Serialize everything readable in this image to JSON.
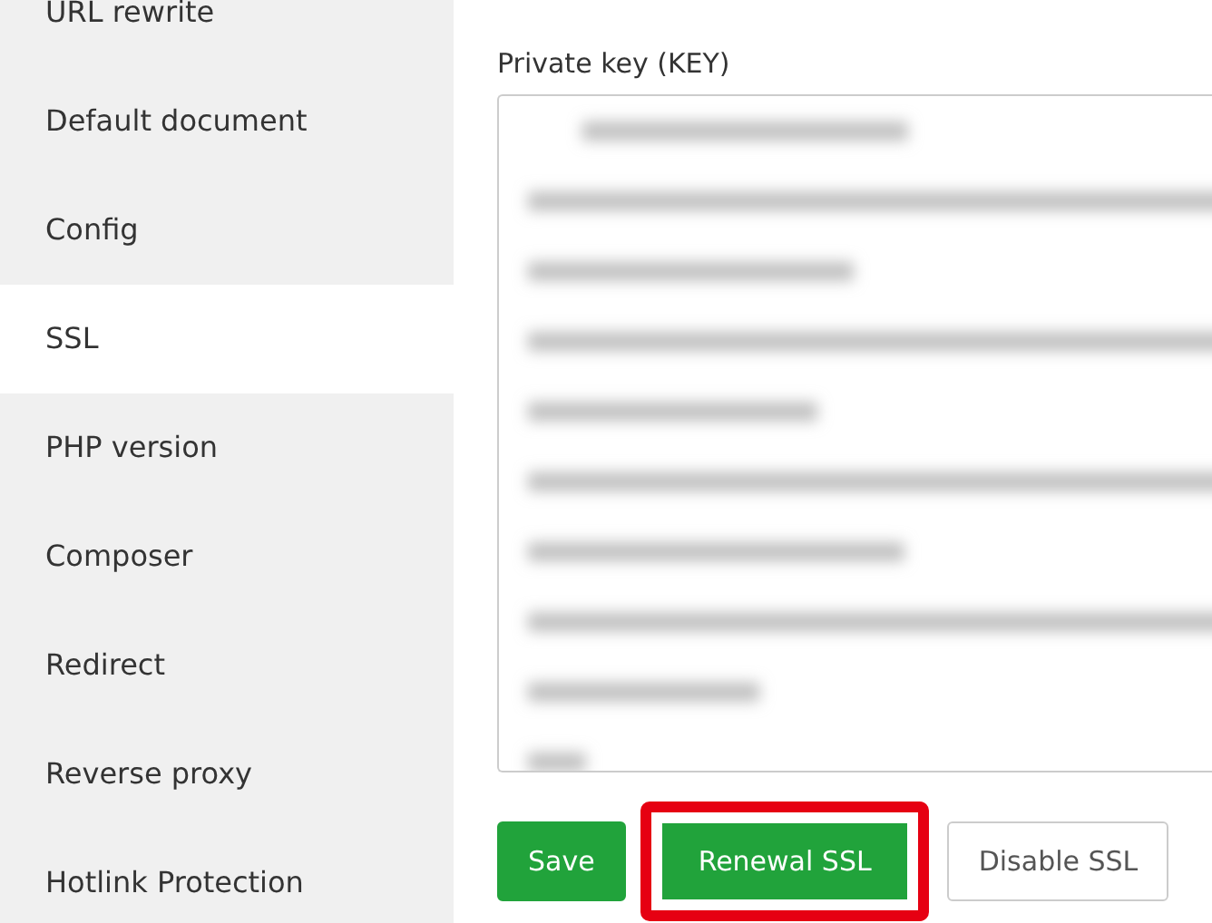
{
  "sidebar": {
    "items": [
      {
        "label": "URL rewrite",
        "selected": false
      },
      {
        "label": "Default document",
        "selected": false
      },
      {
        "label": "Config",
        "selected": false
      },
      {
        "label": "SSL",
        "selected": true
      },
      {
        "label": "PHP version",
        "selected": false
      },
      {
        "label": "Composer",
        "selected": false
      },
      {
        "label": "Redirect",
        "selected": false
      },
      {
        "label": "Reverse proxy",
        "selected": false
      },
      {
        "label": "Hotlink Protection",
        "selected": false
      }
    ]
  },
  "private_key": {
    "label": "Private key (KEY)"
  },
  "buttons": [
    {
      "label": "Save",
      "kind": "primary",
      "highlighted": false
    },
    {
      "label": "Renewal SSL",
      "kind": "primary",
      "highlighted": true
    },
    {
      "label": "Disable SSL",
      "kind": "default",
      "highlighted": false
    }
  ]
}
